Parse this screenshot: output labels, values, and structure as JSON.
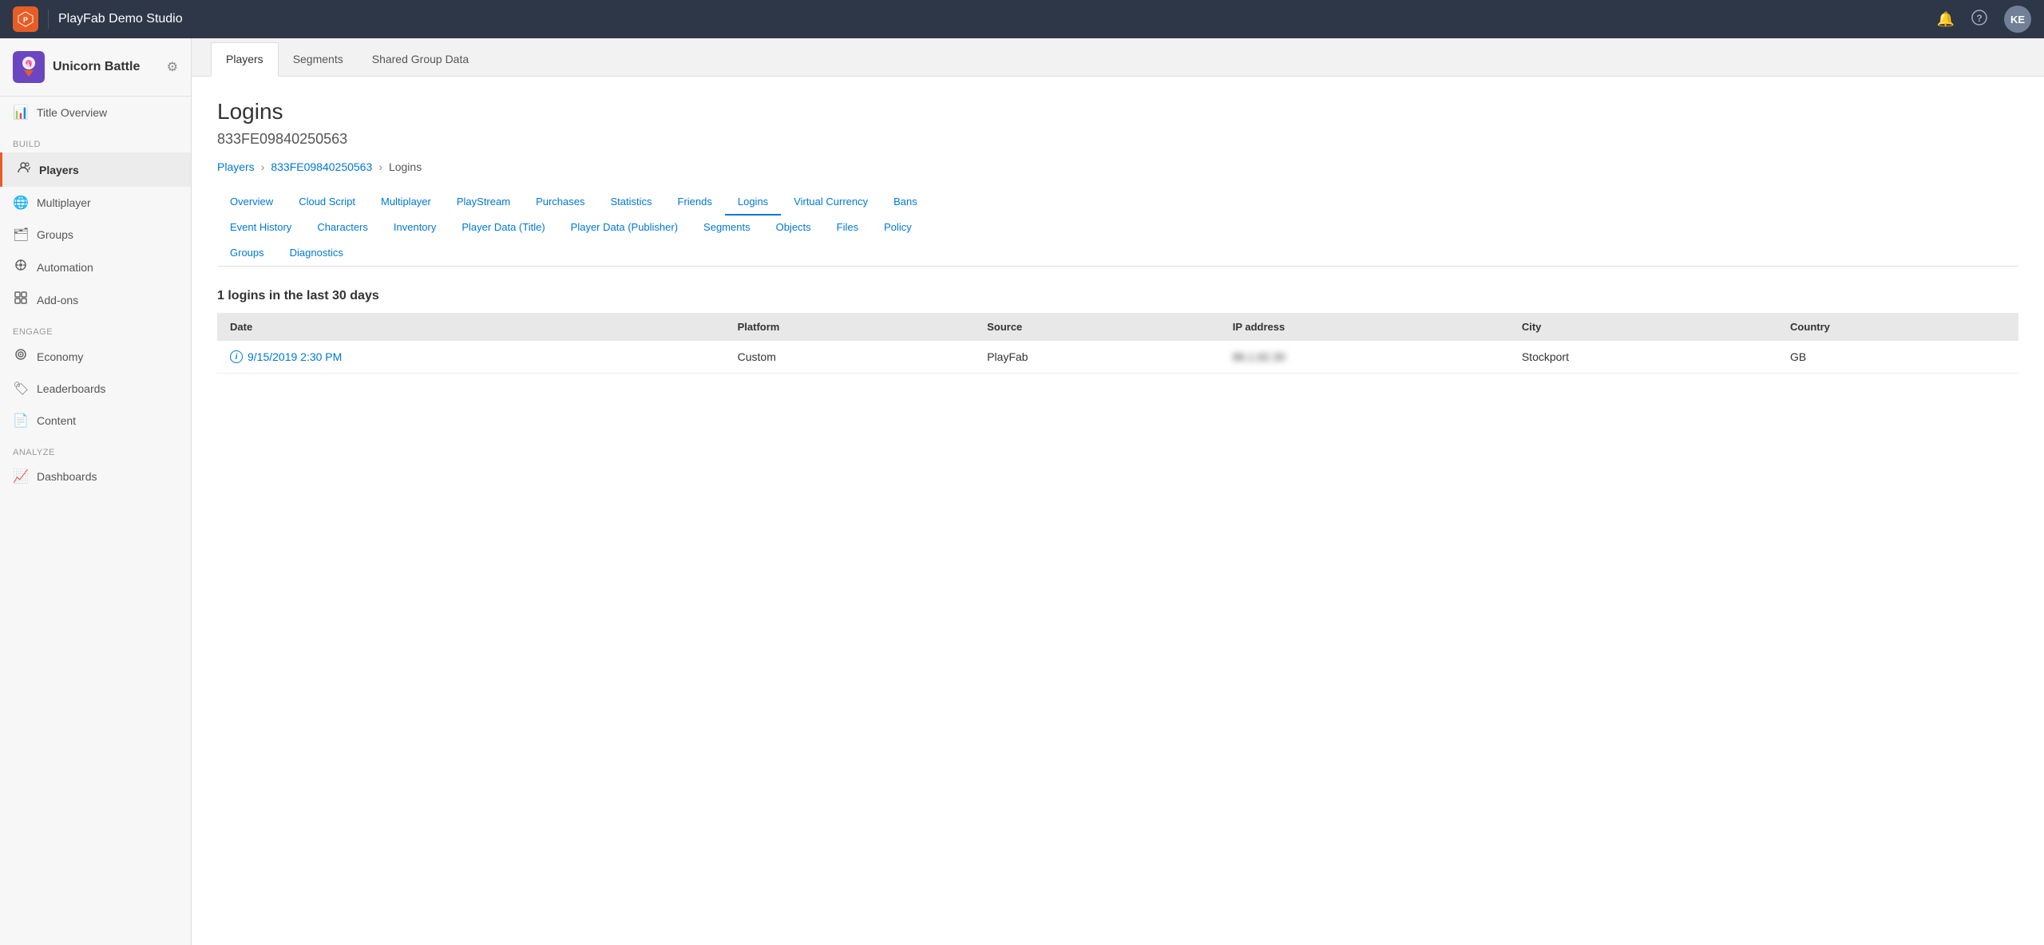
{
  "topNav": {
    "logoText": "P",
    "studioName": "PlayFab Demo Studio",
    "avatarText": "KE"
  },
  "sidebar": {
    "brandName": "Unicorn Battle",
    "sections": [
      {
        "label": "",
        "items": [
          {
            "id": "title-overview",
            "label": "Title Overview",
            "icon": "📊"
          }
        ]
      },
      {
        "label": "BUILD",
        "items": [
          {
            "id": "players",
            "label": "Players",
            "icon": "👤",
            "active": true
          },
          {
            "id": "multiplayer",
            "label": "Multiplayer",
            "icon": "🌐"
          },
          {
            "id": "groups",
            "label": "Groups",
            "icon": "🗂"
          },
          {
            "id": "automation",
            "label": "Automation",
            "icon": "🤖"
          },
          {
            "id": "add-ons",
            "label": "Add-ons",
            "icon": "⊞"
          }
        ]
      },
      {
        "label": "ENGAGE",
        "items": [
          {
            "id": "economy",
            "label": "Economy",
            "icon": "💰"
          },
          {
            "id": "leaderboards",
            "label": "Leaderboards",
            "icon": "🏷"
          },
          {
            "id": "content",
            "label": "Content",
            "icon": "📄"
          }
        ]
      },
      {
        "label": "ANALYZE",
        "items": [
          {
            "id": "dashboards",
            "label": "Dashboards",
            "icon": "📈"
          }
        ]
      }
    ]
  },
  "mainTabs": [
    {
      "id": "players",
      "label": "Players",
      "active": true
    },
    {
      "id": "segments",
      "label": "Segments"
    },
    {
      "id": "shared-group-data",
      "label": "Shared Group Data"
    }
  ],
  "pageTitle": "Logins",
  "pageSubtitle": "833FE09840250563",
  "breadcrumb": {
    "parts": [
      {
        "text": "Players",
        "link": true
      },
      {
        "text": "833FE09840250563",
        "link": true
      },
      {
        "text": "Logins",
        "link": false
      }
    ]
  },
  "subNav": {
    "rows": [
      [
        {
          "id": "overview",
          "label": "Overview"
        },
        {
          "id": "cloud-script",
          "label": "Cloud Script"
        },
        {
          "id": "multiplayer",
          "label": "Multiplayer"
        },
        {
          "id": "playstream",
          "label": "PlayStream"
        },
        {
          "id": "purchases",
          "label": "Purchases"
        },
        {
          "id": "statistics",
          "label": "Statistics"
        },
        {
          "id": "friends",
          "label": "Friends"
        },
        {
          "id": "logins",
          "label": "Logins",
          "active": true
        },
        {
          "id": "virtual-currency",
          "label": "Virtual Currency"
        },
        {
          "id": "bans",
          "label": "Bans"
        }
      ],
      [
        {
          "id": "event-history",
          "label": "Event History"
        },
        {
          "id": "characters",
          "label": "Characters"
        },
        {
          "id": "inventory",
          "label": "Inventory"
        },
        {
          "id": "player-data-title",
          "label": "Player Data (Title)"
        },
        {
          "id": "player-data-publisher",
          "label": "Player Data (Publisher)"
        },
        {
          "id": "segments",
          "label": "Segments"
        },
        {
          "id": "objects",
          "label": "Objects"
        },
        {
          "id": "files",
          "label": "Files"
        },
        {
          "id": "policy",
          "label": "Policy"
        }
      ],
      [
        {
          "id": "groups",
          "label": "Groups"
        },
        {
          "id": "diagnostics",
          "label": "Diagnostics"
        }
      ]
    ]
  },
  "loginsSection": {
    "summary": "1 logins in the last 30 days",
    "tableHeaders": [
      "Date",
      "Platform",
      "Source",
      "IP address",
      "City",
      "Country"
    ],
    "tableRows": [
      {
        "date": "9/15/2019 2:30 PM",
        "platform": "Custom",
        "source": "PlayFab",
        "ipAddress": "86.1.62.30",
        "city": "Stockport",
        "country": "GB"
      }
    ]
  }
}
